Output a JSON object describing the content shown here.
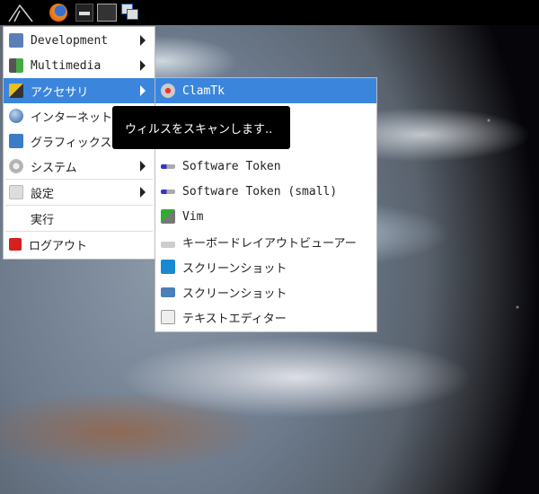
{
  "panel": {
    "icons": [
      "start-menu-icon",
      "firefox-icon",
      "terminal-icon",
      "desktop-icon",
      "windows-icon"
    ]
  },
  "menu": {
    "items": [
      {
        "label": "Development",
        "icon": "development-icon",
        "submenu": true
      },
      {
        "label": "Multimedia",
        "icon": "multimedia-icon",
        "submenu": true
      },
      {
        "label": "アクセサリ",
        "icon": "accessories-icon",
        "submenu": true,
        "selected": true
      },
      {
        "label": "インターネット",
        "icon": "internet-icon",
        "submenu": true
      },
      {
        "label": "グラフィックス",
        "icon": "graphics-icon",
        "submenu": true
      },
      {
        "label": "システム",
        "icon": "system-icon",
        "submenu": true
      },
      {
        "label": "設定",
        "icon": "settings-icon",
        "submenu": true
      },
      {
        "label": "実行",
        "icon": "",
        "submenu": false
      },
      {
        "label": "ログアウト",
        "icon": "logout-icon",
        "submenu": false
      }
    ]
  },
  "submenu": {
    "items": [
      {
        "label": "ClamTk",
        "icon": "clamtk-icon"
      },
      {
        "label": "Software Token",
        "icon": "software-token-icon"
      },
      {
        "label": "Software Token (small)",
        "icon": "software-token-icon"
      },
      {
        "label": "Vim",
        "icon": "vim-icon"
      },
      {
        "label": "キーボードレイアウトビューアー",
        "icon": "keyboard-icon"
      },
      {
        "label": "スクリーンショット",
        "icon": "screenshot-icon"
      },
      {
        "label": "スクリーンショット",
        "icon": "screenshot-icon"
      },
      {
        "label": "テキストエディター",
        "icon": "text-editor-icon"
      }
    ]
  },
  "tooltip": "ウィルスをスキャンします.."
}
